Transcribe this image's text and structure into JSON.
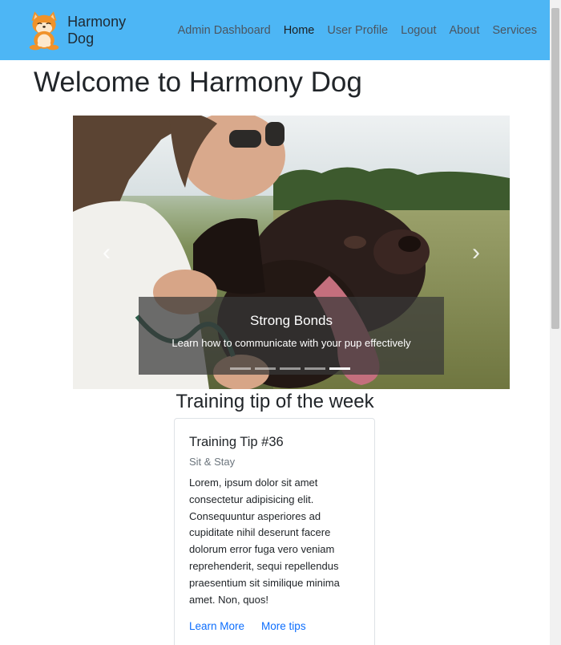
{
  "navbar": {
    "brand": "Harmony Dog",
    "links": [
      {
        "label": "Admin Dashboard"
      },
      {
        "label": "Home"
      },
      {
        "label": "User Profile"
      },
      {
        "label": "Logout"
      },
      {
        "label": "About"
      },
      {
        "label": "Services"
      }
    ],
    "active_link": "Home"
  },
  "main": {
    "title": "Welcome to Harmony Dog",
    "carousel": {
      "slide": {
        "title": "Strong Bonds",
        "text": "Learn how to communicate with your pup effectively"
      },
      "indicator_count": 5,
      "active_indicator": 5,
      "prev_icon": "chevron-left-icon",
      "next_icon": "chevron-right-icon"
    },
    "tip_section": {
      "heading": "Training tip of the week",
      "card": {
        "title": "Training Tip #36",
        "subtitle": "Sit & Stay",
        "body": "Lorem, ipsum dolor sit amet consectetur adipisicing elit. Consequuntur asperiores ad cupiditate nihil deserunt facere dolorum error fuga vero veniam reprehenderit, sequi repellendus praesentium sit similique minima amet. Non, quos!",
        "links": [
          {
            "label": "Learn More"
          },
          {
            "label": "More tips"
          }
        ]
      }
    }
  },
  "colors": {
    "navbar_bg": "#4db6f5",
    "link": "#0d6efd"
  }
}
